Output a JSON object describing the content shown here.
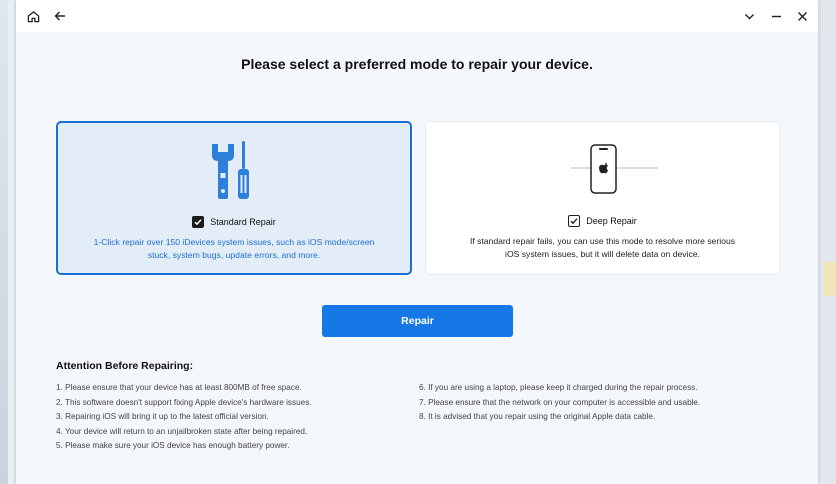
{
  "window": {
    "title_icons": [
      "home-icon",
      "back-arrow-icon"
    ],
    "controls": [
      "chevron-down-icon",
      "minimize-icon",
      "close-icon"
    ]
  },
  "heading": "Please select a preferred mode to repair your device.",
  "modes": {
    "standard": {
      "label": "Standard Repair",
      "checked": true,
      "desc1": "1-Click repair over 150 iDevices system issues, such as iOS mode/screen",
      "desc2": "stuck, system bugs, update errors, and more.",
      "icon": "wrench-screwdriver-icon"
    },
    "deep": {
      "label": "Deep Repair",
      "checked": true,
      "desc1": "If standard repair fails, you can use this mode to resolve more serious",
      "desc2": "iOS system issues, but it will delete data on device.",
      "icon": "iphone-icon"
    }
  },
  "repair_button": "Repair",
  "attention": {
    "title": "Attention Before Repairing:",
    "left": [
      "1. Please ensure that your device has at least 800MB of free space.",
      "2. This software doesn't support fixing Apple device's hardware issues.",
      "3. Repairing iOS will bring it up to the latest official version.",
      "4. Your device will return to an unjailbroken state after being repaired.",
      "5. Please make sure your iOS device has enough battery power."
    ],
    "right": [
      "6. If you are using a laptop, please keep it charged during the repair process.",
      "7. Please ensure that the network on your computer is accessible and usable.",
      "8. It is advised that you repair using the original Apple data cable."
    ]
  },
  "colors": {
    "accent": "#1677e6",
    "selected_border": "#1c6fd1",
    "selected_bg": "#e3edf8",
    "background": "#f4f7fb"
  }
}
